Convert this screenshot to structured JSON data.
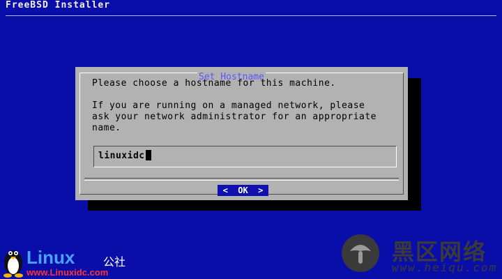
{
  "header": {
    "title": "FreeBSD Installer"
  },
  "dialog": {
    "title": "Set Hostname",
    "message": [
      "Please choose a hostname for this machine.",
      "If you are running on a managed network, please",
      "ask your network administrator for an appropriate",
      "name."
    ],
    "hostname_value": "linuxidc",
    "ok_label": "<  OK  >"
  },
  "watermarks": {
    "linux_word": "Linux",
    "linux_suffix": "公社",
    "linux_url": "www.Linuxidc.com",
    "heiqu_name": "黑区网络",
    "heiqu_url": "www.heiqu.com"
  },
  "colors": {
    "background": "#0a0ea8",
    "dialog_bg": "#b2b2b2",
    "title_text": "#5a55ff",
    "button_bg": "#1010b0"
  },
  "icons": [
    "tux-penguin-icon",
    "mushroom-icon",
    "text-cursor"
  ]
}
